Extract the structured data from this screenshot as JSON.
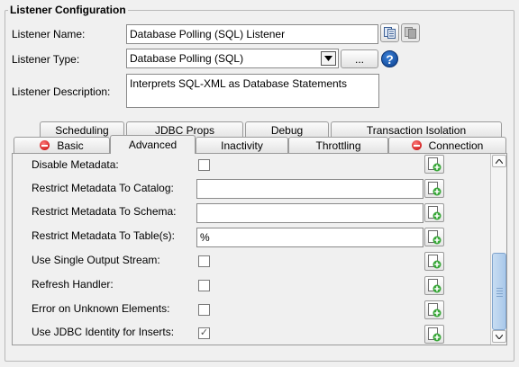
{
  "group_title": "Listener Configuration",
  "fields": {
    "name_label": "Listener Name:",
    "name_value": "Database Polling (SQL) Listener",
    "type_label": "Listener Type:",
    "type_value": "Database Polling (SQL)",
    "browse_label": "...",
    "description_label": "Listener Description:",
    "description_value": "Interprets SQL-XML as Database Statements"
  },
  "tabs": {
    "back_row": [
      "Scheduling",
      "JDBC Props",
      "Debug",
      "Transaction Isolation"
    ],
    "front_row": [
      {
        "label": "Basic",
        "error": true
      },
      {
        "label": "Advanced",
        "active": true
      },
      {
        "label": "Inactivity"
      },
      {
        "label": "Throttling"
      },
      {
        "label": "Connection",
        "error": true
      }
    ]
  },
  "advanced_rows": [
    {
      "label": "Disable Metadata:",
      "kind": "checkbox",
      "checked": false
    },
    {
      "label": "Restrict Metadata To Catalog:",
      "kind": "text",
      "value": ""
    },
    {
      "label": "Restrict Metadata To Schema:",
      "kind": "text",
      "value": ""
    },
    {
      "label": "Restrict Metadata To Table(s):",
      "kind": "text",
      "value": "%"
    },
    {
      "label": "Use Single Output Stream:",
      "kind": "checkbox",
      "checked": false
    },
    {
      "label": "Refresh Handler:",
      "kind": "checkbox",
      "checked": false
    },
    {
      "label": "Error on Unknown Elements:",
      "kind": "checkbox",
      "checked": false
    },
    {
      "label": "Use JDBC Identity for Inserts:",
      "kind": "checkbox",
      "checked": true
    }
  ],
  "checkmark_glyph": "✓",
  "icons": {
    "copy": "copy-icon",
    "paste": "paste-icon",
    "help": "?",
    "add": "add-property-icon",
    "dropdown": "chevron-down-icon"
  },
  "colors": {
    "help_blue": "#0b3f8c",
    "error_red": "#c00000",
    "add_green": "#2a9a2a",
    "scroll_thumb": "#a9c8ea"
  }
}
